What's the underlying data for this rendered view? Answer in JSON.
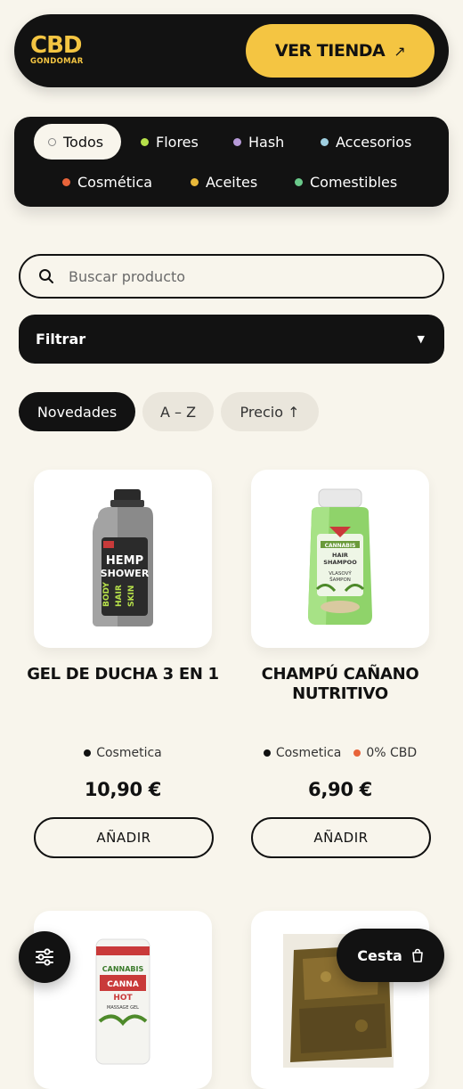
{
  "header": {
    "logo_line1": "CBD",
    "logo_line2": "GONDOMAR",
    "shop_button": "VER TIENDA",
    "shop_arrow": "↗"
  },
  "categories": [
    {
      "label": "Todos",
      "color": "#f8f5ec",
      "active": true
    },
    {
      "label": "Flores",
      "color": "#b6e04a"
    },
    {
      "label": "Hash",
      "color": "#b69ad8"
    },
    {
      "label": "Accesorios",
      "color": "#9fcfe0"
    },
    {
      "label": "Cosmética",
      "color": "#e8643a"
    },
    {
      "label": "Aceites",
      "color": "#e8b83a"
    },
    {
      "label": "Comestibles",
      "color": "#6ac98a"
    }
  ],
  "search": {
    "placeholder": "Buscar producto"
  },
  "filter": {
    "label": "Filtrar",
    "caret": "▼"
  },
  "sort": {
    "options": [
      "Novedades",
      "A – Z",
      "Precio ↑"
    ],
    "selected": "Novedades"
  },
  "products": [
    {
      "title": "GEL DE DUCHA 3 EN 1",
      "tags": [
        {
          "label": "Cosmetica",
          "color": "#111111"
        }
      ],
      "price": "10,90 €",
      "button": "AÑADIR",
      "image": "hemp-shower-gel-bottle"
    },
    {
      "title": "CHAMPÚ CAÑANO NUTRITIVO",
      "tags": [
        {
          "label": "Cosmetica",
          "color": "#111111"
        },
        {
          "label": "0% CBD",
          "color": "#e8643a"
        }
      ],
      "price": "6,90 €",
      "button": "AÑADIR",
      "image": "cannabis-hair-shampoo-bottle"
    },
    {
      "image": "cannabis-hot-massage-gel-tube"
    },
    {
      "image": "hash-block"
    }
  ],
  "bottom": {
    "filters_icon": "sliders-icon",
    "cart_label": "Cesta",
    "cart_icon": "bag-icon"
  },
  "colors": {
    "accent": "#f4c542",
    "dark": "#121212",
    "background": "#f8f5ec"
  }
}
